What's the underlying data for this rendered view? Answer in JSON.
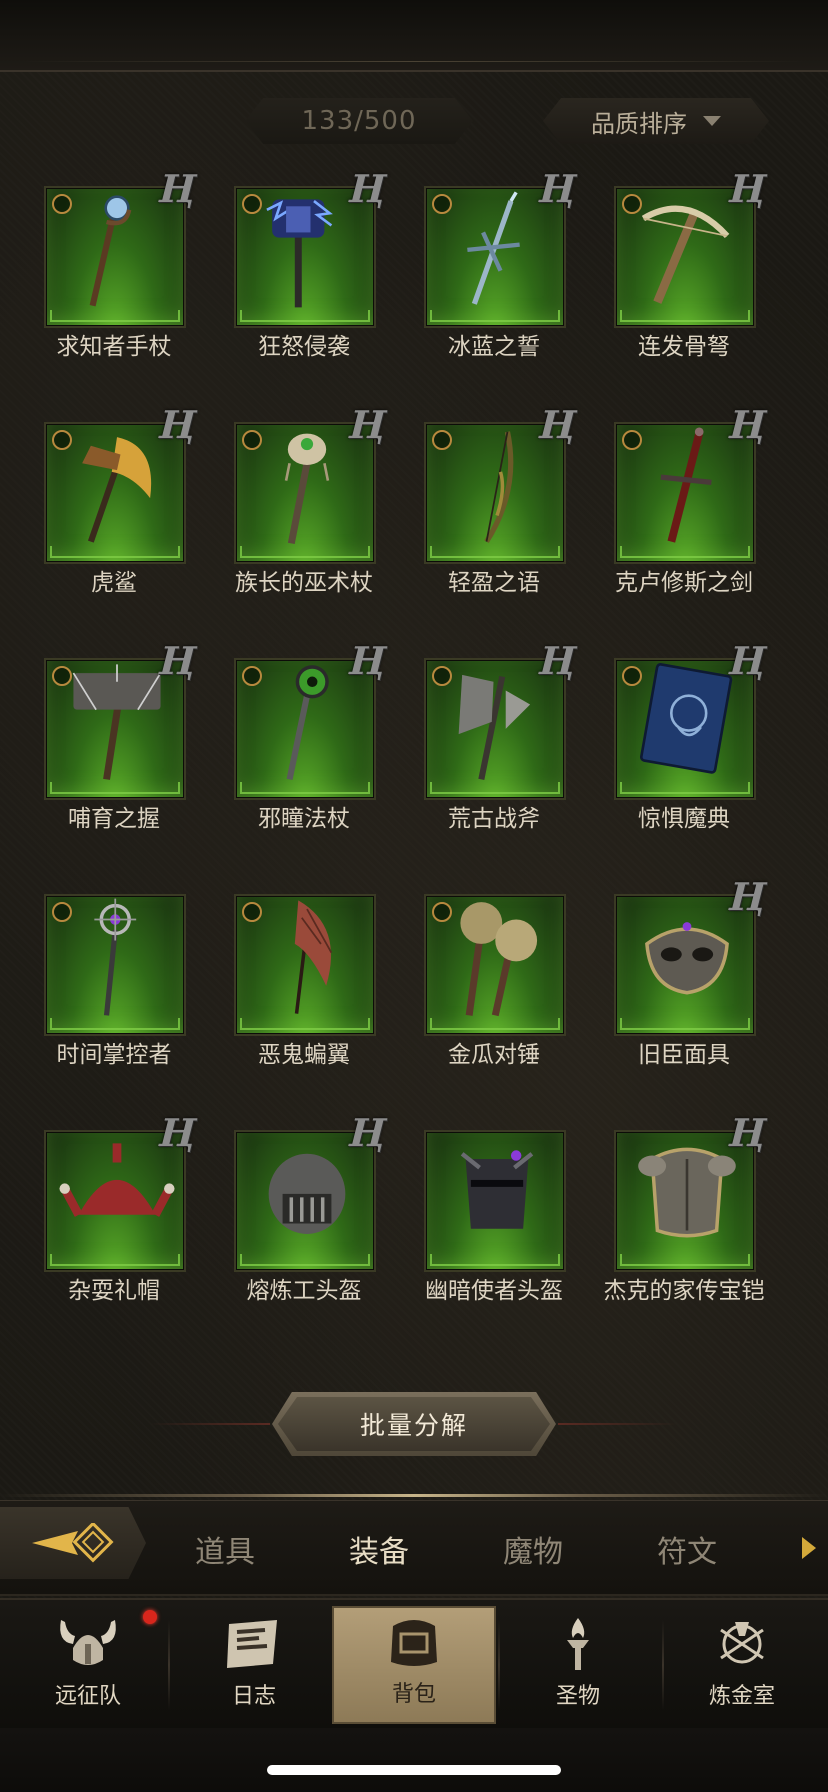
{
  "header": {
    "count": "133/500",
    "sort_label": "品质排序"
  },
  "items": [
    {
      "name": "求知者手杖",
      "has_select": true,
      "has_rune": true,
      "art": "staff-orb"
    },
    {
      "name": "狂怒侵袭",
      "has_select": true,
      "has_rune": true,
      "art": "mace-lightning"
    },
    {
      "name": "冰蓝之誓",
      "has_select": true,
      "has_rune": true,
      "art": "ice-sword"
    },
    {
      "name": "连发骨弩",
      "has_select": true,
      "has_rune": true,
      "art": "crossbow"
    },
    {
      "name": "虎鲨",
      "has_select": true,
      "has_rune": true,
      "art": "axe-gold"
    },
    {
      "name": "族长的巫术杖",
      "has_select": true,
      "has_rune": true,
      "art": "staff-skull"
    },
    {
      "name": "轻盈之语",
      "has_select": true,
      "has_rune": true,
      "art": "bow"
    },
    {
      "name": "克卢修斯之剑",
      "has_select": true,
      "has_rune": true,
      "art": "red-sword"
    },
    {
      "name": "哺育之握",
      "has_select": true,
      "has_rune": true,
      "art": "hammer"
    },
    {
      "name": "邪瞳法杖",
      "has_select": true,
      "has_rune": true,
      "art": "staff-eye"
    },
    {
      "name": "荒古战斧",
      "has_select": true,
      "has_rune": true,
      "art": "battle-axe"
    },
    {
      "name": "惊惧魔典",
      "has_select": true,
      "has_rune": true,
      "art": "tome"
    },
    {
      "name": "时间掌控者",
      "has_select": true,
      "has_rune": false,
      "art": "scepter"
    },
    {
      "name": "恶鬼蝙翼",
      "has_select": true,
      "has_rune": false,
      "art": "wing-blade"
    },
    {
      "name": "金瓜对锤",
      "has_select": true,
      "has_rune": false,
      "art": "twin-maces"
    },
    {
      "name": "旧臣面具",
      "has_select": false,
      "has_rune": true,
      "art": "mask"
    },
    {
      "name": "杂耍礼帽",
      "has_select": false,
      "has_rune": true,
      "art": "jester-hat"
    },
    {
      "name": "熔炼工头盔",
      "has_select": false,
      "has_rune": true,
      "art": "helm-round"
    },
    {
      "name": "幽暗使者头盔",
      "has_select": false,
      "has_rune": false,
      "art": "helm-dark"
    },
    {
      "name": "杰克的家传宝铠",
      "has_select": false,
      "has_rune": true,
      "art": "armor"
    }
  ],
  "bulk_button": "批量分解",
  "tabs": [
    {
      "label": "道具",
      "active": false
    },
    {
      "label": "装备",
      "active": true
    },
    {
      "label": "魔物",
      "active": false
    },
    {
      "label": "符文",
      "active": false
    }
  ],
  "nav": [
    {
      "label": "远征队",
      "icon": "viking-helmet-icon",
      "active": false,
      "badge": true
    },
    {
      "label": "日志",
      "icon": "scroll-icon",
      "active": false,
      "badge": false
    },
    {
      "label": "背包",
      "icon": "backpack-icon",
      "active": true,
      "badge": false
    },
    {
      "label": "圣物",
      "icon": "torch-icon",
      "active": false,
      "badge": false
    },
    {
      "label": "炼金室",
      "icon": "alchemy-icon",
      "active": false,
      "badge": false
    }
  ],
  "rune_glyph": "Ң"
}
